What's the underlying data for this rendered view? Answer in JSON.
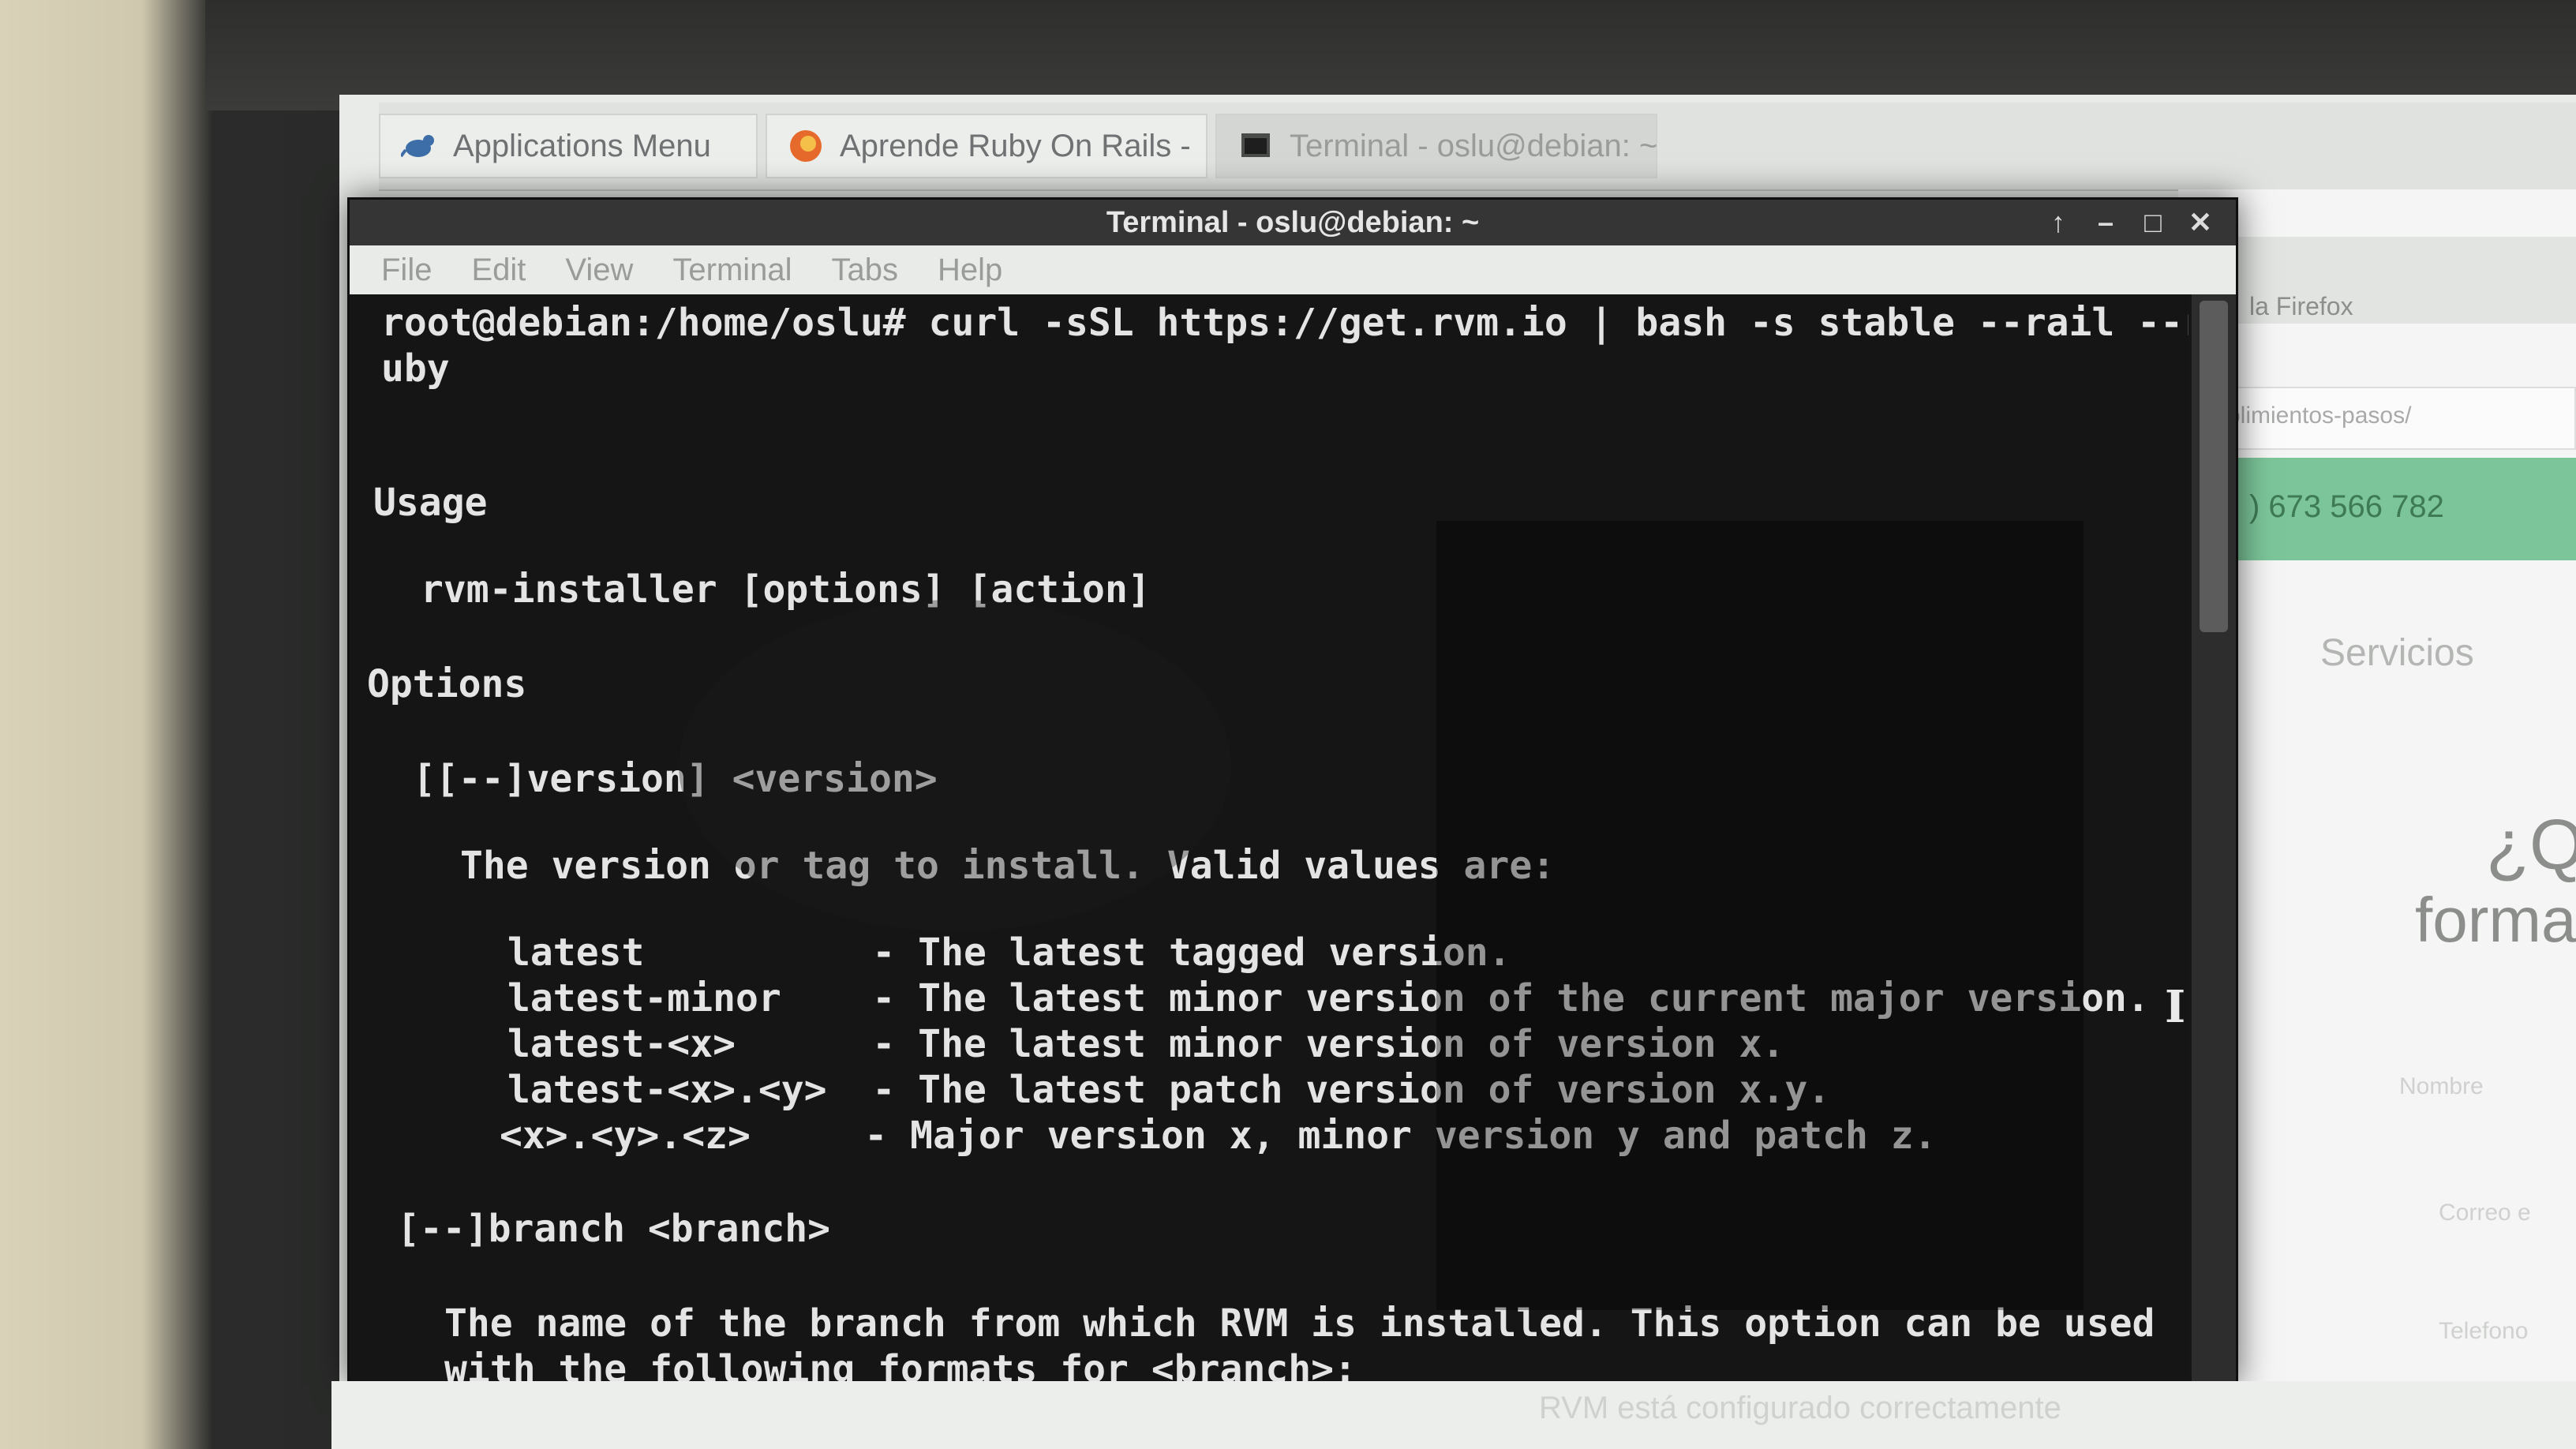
{
  "colors": {
    "terminal_bg": "#141514",
    "terminal_text": "#e4e4e4",
    "panel_bg": "#dfe2df",
    "firefox_green": "#7cc59a"
  },
  "panel": {
    "app_menu": {
      "label": "Applications Menu",
      "icon": "xfce-mouse-icon"
    },
    "tabs": [
      {
        "label": "Aprende Ruby On Rails -",
        "icon": "firefox-icon"
      },
      {
        "label": "Terminal - oslu@debian: ~",
        "icon": "terminal-icon"
      }
    ]
  },
  "firefox": {
    "title_fragment": "la Firefox",
    "url_fragment": "olimientos-pasos/",
    "phone_fragment": ") 673 566 782",
    "servicios": "Servicios",
    "question_fragment": "¿Q",
    "forma_fragment": "forma",
    "field1": "Nombre",
    "field2": "Correo e",
    "field3": "Telefono"
  },
  "terminal": {
    "title": "Terminal - oslu@debian: ~",
    "controls": [
      "↑",
      "–",
      "□",
      "✕"
    ],
    "menu": [
      "File",
      "Edit",
      "View",
      "Terminal",
      "Tabs",
      "Help"
    ],
    "lines": {
      "prompt": "root@debian:/home/oslu# curl -sSL https://get.rvm.io | bash -s stable --rail --r",
      "wrap": "uby",
      "usage_heading": "Usage",
      "usage_cmd": "rvm-installer [options] [action]",
      "options_heading": "Options",
      "version_opt": "[[--]version] <version>",
      "version_desc": "The version or tag to install. Valid values are:",
      "v1": "latest          - The latest tagged version.",
      "v2": "latest-minor    - The latest minor version of the current major version.",
      "v3": "latest-<x>      - The latest minor version of version x.",
      "v4": "latest-<x>.<y>  - The latest patch version of version x.y.",
      "v5": "<x>.<y>.<z>     - Major version x, minor version y and patch z.",
      "branch_opt": "[--]branch <branch>",
      "branch_desc1": "The name of the branch from which RVM is installed. This option can be used",
      "branch_desc2": "with the following formats for <branch>:"
    }
  },
  "bottom_text": "RVM está configurado correctamente"
}
